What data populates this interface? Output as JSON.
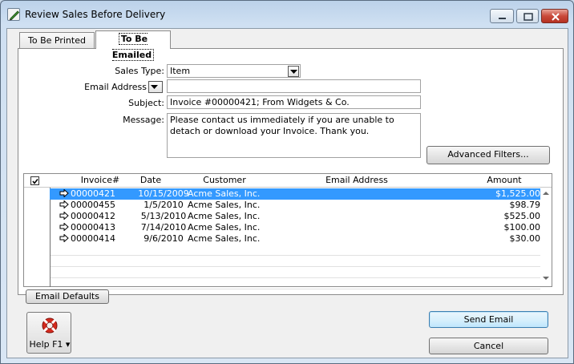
{
  "window": {
    "title": "Review Sales Before Delivery"
  },
  "tabs": [
    {
      "label": "To Be Printed"
    },
    {
      "label": "To Be Emailed"
    }
  ],
  "form": {
    "sales_type_label": "Sales Type:",
    "sales_type_value": "Item",
    "email_address_label": "Email Address",
    "email_address_value": "",
    "subject_label": "Subject:",
    "subject_value": "Invoice #00000421; From Widgets & Co.",
    "message_label": "Message:",
    "message_value": "Please contact us immediately if you are unable to detach or download your Invoice. Thank you."
  },
  "buttons": {
    "advanced_filters": "Advanced Filters...",
    "email_defaults": "Email Defaults",
    "send_email": "Send Email",
    "cancel": "Cancel",
    "help": "Help F1"
  },
  "grid": {
    "columns": [
      "Invoice#",
      "Date",
      "Customer",
      "Email Address",
      "Amount"
    ],
    "rows": [
      {
        "invoice": "00000421",
        "date": "10/15/2009",
        "customer": "Acme Sales, Inc.",
        "email": "",
        "amount": "$1,525.00",
        "selected": true
      },
      {
        "invoice": "00000455",
        "date": "1/5/2010",
        "customer": "Acme Sales, Inc.",
        "email": "",
        "amount": "$98.79",
        "selected": false
      },
      {
        "invoice": "00000412",
        "date": "5/13/2010",
        "customer": "Acme Sales, Inc.",
        "email": "",
        "amount": "$525.00",
        "selected": false
      },
      {
        "invoice": "00000413",
        "date": "7/14/2010",
        "customer": "Acme Sales, Inc.",
        "email": "",
        "amount": "$100.00",
        "selected": false
      },
      {
        "invoice": "00000414",
        "date": "9/6/2010",
        "customer": "Acme Sales, Inc.",
        "email": "",
        "amount": "$30.00",
        "selected": false
      }
    ]
  },
  "colors": {
    "selection": "#3399ff",
    "close_button": "#c9493a"
  }
}
